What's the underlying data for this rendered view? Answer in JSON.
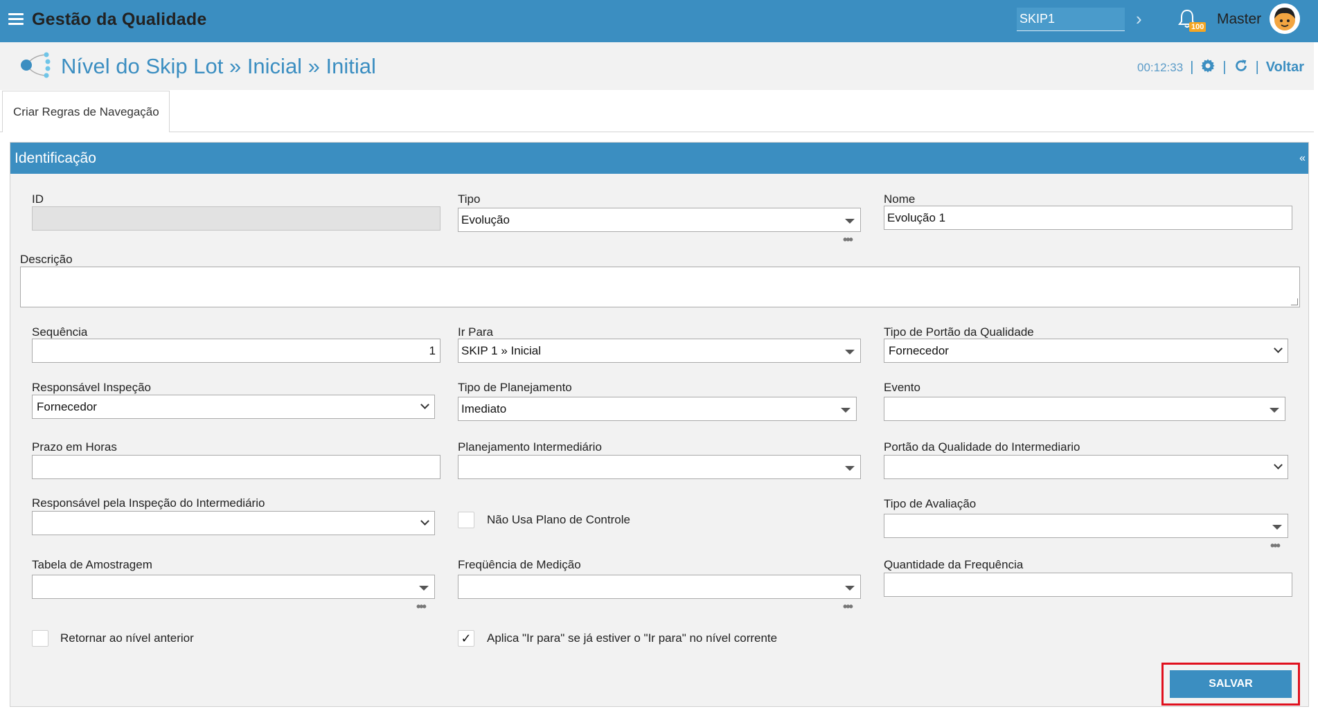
{
  "topbar": {
    "app_title": "Gestão da Qualidade",
    "search_value": "SKIP1",
    "notification_count": "100",
    "user_name": "Master"
  },
  "header": {
    "title": "Nível do Skip Lot » Inicial » Initial",
    "timer": "00:12:33",
    "back_label": "Voltar"
  },
  "tabs": [
    {
      "label": "Criar Regras de Navegação",
      "active": true
    }
  ],
  "section": {
    "title": "Identificação",
    "collapse_glyph": "«"
  },
  "form": {
    "id": {
      "label": "ID",
      "value": ""
    },
    "tipo": {
      "label": "Tipo",
      "value": "Evolução"
    },
    "nome": {
      "label": "Nome",
      "value": "Evolução 1"
    },
    "descricao": {
      "label": "Descrição",
      "value": ""
    },
    "sequencia": {
      "label": "Sequência",
      "value": "1"
    },
    "ir_para": {
      "label": "Ir Para",
      "value": "SKIP 1 » Inicial"
    },
    "tipo_portao": {
      "label": "Tipo de Portão da Qualidade",
      "value": "Fornecedor"
    },
    "resp_inspecao": {
      "label": "Responsável Inspeção",
      "value": "Fornecedor"
    },
    "tipo_planejamento": {
      "label": "Tipo de Planejamento",
      "value": "Imediato"
    },
    "evento": {
      "label": "Evento",
      "value": ""
    },
    "prazo_horas": {
      "label": "Prazo em Horas",
      "value": ""
    },
    "plan_intermediario": {
      "label": "Planejamento Intermediário",
      "value": ""
    },
    "portao_intermediario": {
      "label": "Portão da Qualidade do Intermediario",
      "value": ""
    },
    "resp_intermediario": {
      "label": "Responsável pela Inspeção do Intermediário",
      "value": ""
    },
    "nao_usa_plano": {
      "label": "Não Usa Plano de Controle",
      "checked": false
    },
    "tipo_avaliacao": {
      "label": "Tipo de Avaliação",
      "value": ""
    },
    "tabela_amostragem": {
      "label": "Tabela de Amostragem",
      "value": ""
    },
    "frequencia_medicao": {
      "label": "Freqüência de Medição",
      "value": ""
    },
    "qtd_frequencia": {
      "label": "Quantidade da Frequência",
      "value": ""
    },
    "retornar_nivel": {
      "label": "Retornar ao nível anterior",
      "checked": false
    },
    "aplica_ir_para": {
      "label": "Aplica \"Ir para\" se já estiver o \"Ir para\" no nível corrente",
      "checked": true,
      "check_glyph": "✓"
    },
    "more_glyph": "•••"
  },
  "actions": {
    "save_label": "SALVAR"
  },
  "colors": {
    "primary": "#3b8ec1",
    "badge": "#f5a623",
    "highlight": "#e0101e"
  },
  "icons": [
    "menu-icon",
    "chevron-right-icon",
    "bell-icon",
    "avatar",
    "hierarchy-icon",
    "gear-icon",
    "refresh-icon"
  ]
}
